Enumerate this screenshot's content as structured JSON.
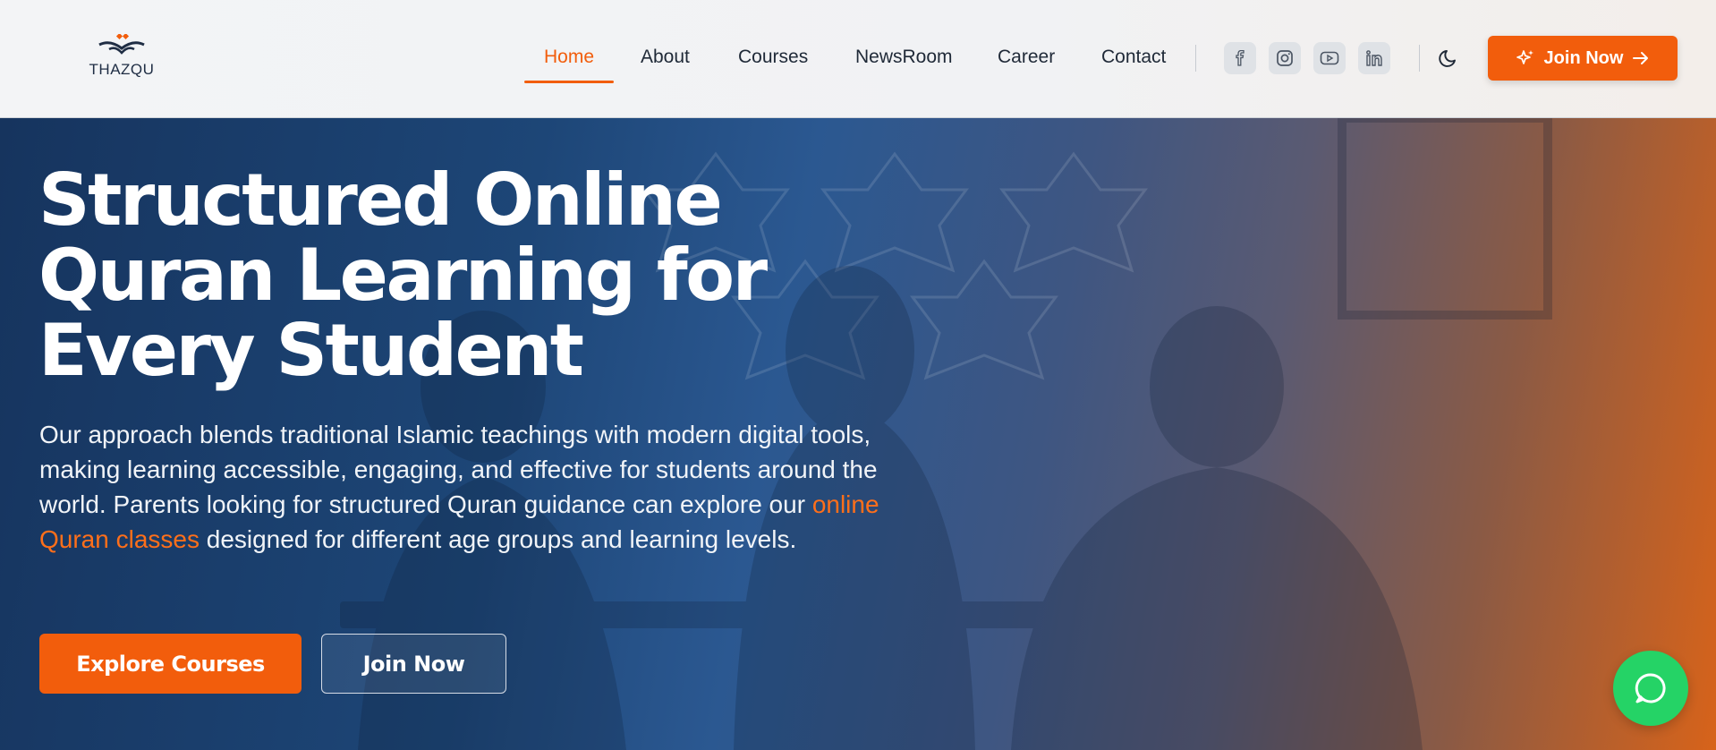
{
  "brand": {
    "name": "THAZQU",
    "accent": "#f25d0c",
    "navy": "#1f2d44"
  },
  "nav": {
    "items": [
      {
        "label": "Home",
        "active": true
      },
      {
        "label": "About",
        "active": false
      },
      {
        "label": "Courses",
        "active": false
      },
      {
        "label": "NewsRoom",
        "active": false
      },
      {
        "label": "Career",
        "active": false
      },
      {
        "label": "Contact",
        "active": false
      }
    ]
  },
  "social": {
    "icons": [
      "facebook-icon",
      "instagram-icon",
      "youtube-icon",
      "linkedin-icon"
    ]
  },
  "header": {
    "join_label": "Join Now",
    "theme_icon": "moon-icon"
  },
  "hero": {
    "title": "Structured Online Quran Learning for Every Student",
    "desc_part1": "Our approach blends traditional Islamic teachings with modern digital tools, making learning accessible, engaging, and effective for students around the world. Parents looking for structured Quran guidance can explore our ",
    "desc_link": "online Quran classes",
    "desc_part2": " designed for different age groups and learning levels.",
    "primary_cta": "Explore Courses",
    "secondary_cta": "Join Now"
  },
  "chat": {
    "icon": "whatsapp-chat-icon",
    "color": "#25d366"
  }
}
